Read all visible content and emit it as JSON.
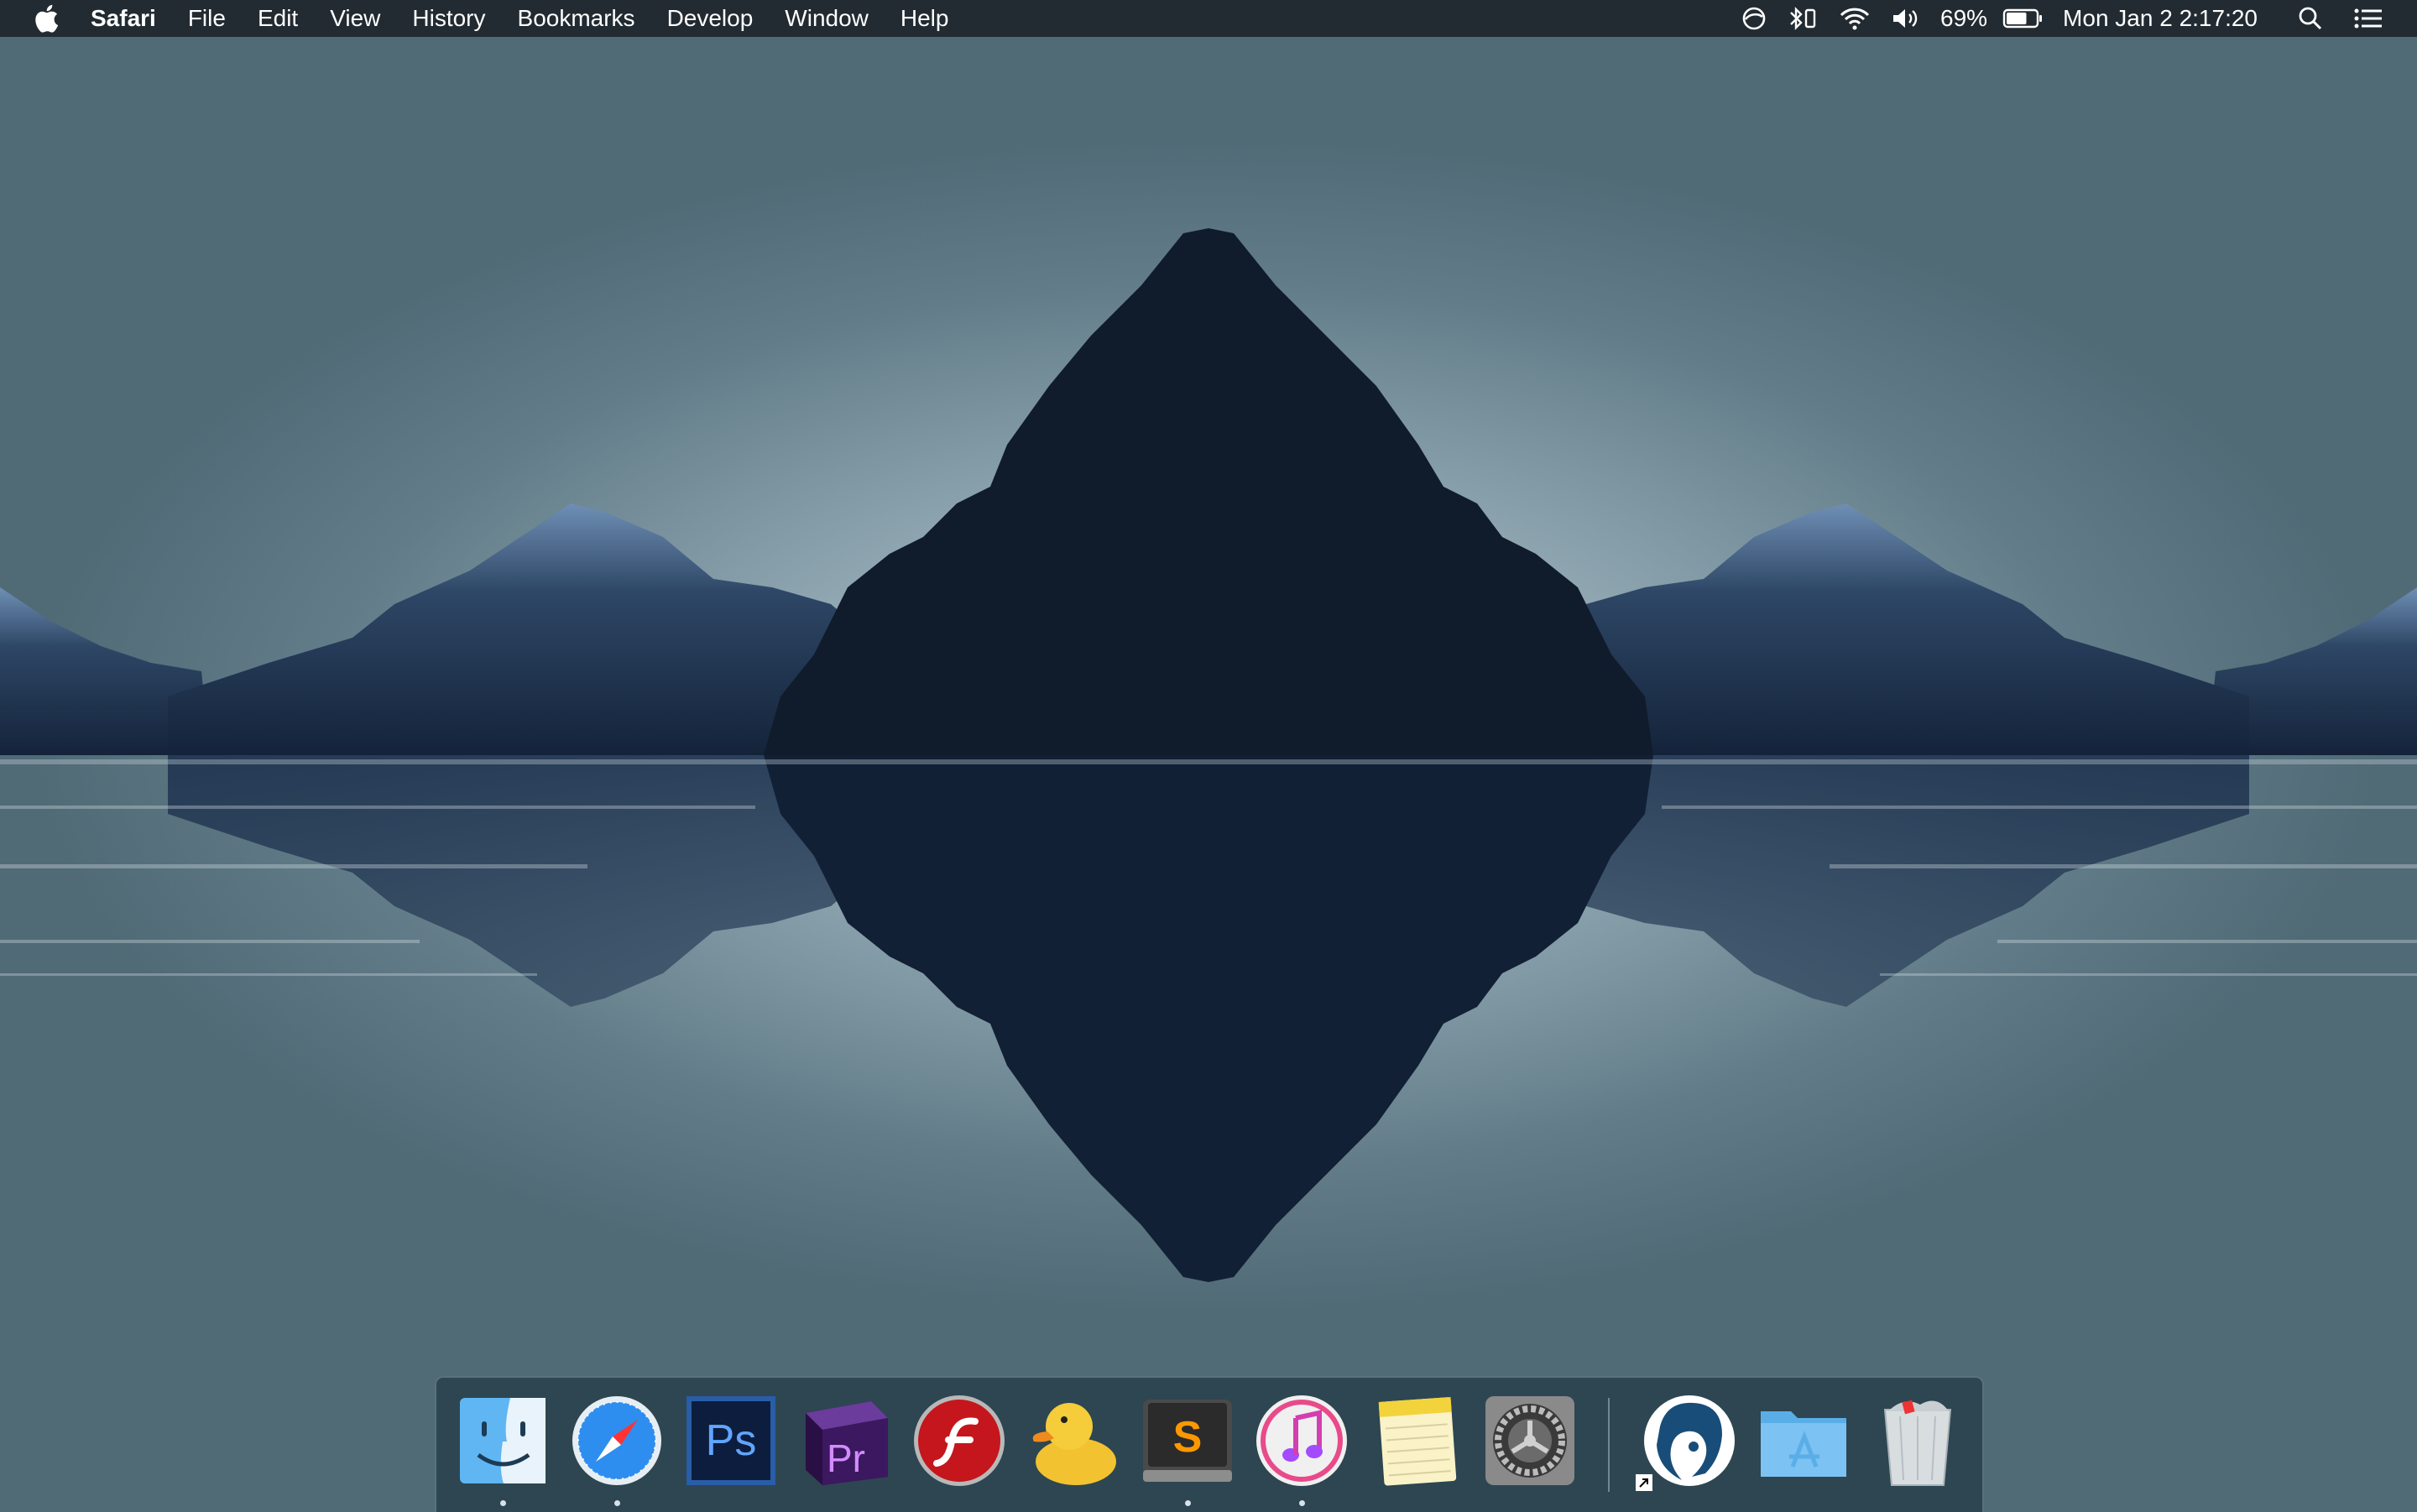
{
  "menubar": {
    "app_name": "Safari",
    "items": [
      "File",
      "Edit",
      "View",
      "History",
      "Bookmarks",
      "Develop",
      "Window",
      "Help"
    ],
    "battery_percent": "69%",
    "battery_level": 0.69,
    "clock": "Mon Jan 2  2:17:20",
    "status_icons": [
      "sync-icon",
      "bluetooth-icon",
      "wifi-icon",
      "volume-icon",
      "battery-icon",
      "spotlight-search-icon",
      "notification-center-icon"
    ]
  },
  "dock": {
    "apps": [
      {
        "name": "Finder",
        "icon": "finder-icon",
        "running": true
      },
      {
        "name": "Safari",
        "icon": "safari-icon",
        "running": true
      },
      {
        "name": "Adobe Photoshop",
        "icon": "photoshop-icon",
        "running": false,
        "label": "Ps"
      },
      {
        "name": "Adobe Premiere Pro",
        "icon": "premiere-icon",
        "running": false,
        "label": "Pr"
      },
      {
        "name": "Adobe Flash Player",
        "icon": "flash-icon",
        "running": false
      },
      {
        "name": "Cyberduck",
        "icon": "cyberduck-icon",
        "running": false
      },
      {
        "name": "Sublime Text",
        "icon": "sublime-text-icon",
        "running": true,
        "label": "S"
      },
      {
        "name": "iTunes",
        "icon": "itunes-icon",
        "running": true
      },
      {
        "name": "Notes",
        "icon": "notes-icon",
        "running": false
      },
      {
        "name": "System Preferences",
        "icon": "system-preferences-icon",
        "running": false
      },
      {
        "name": "Profile",
        "icon": "profile-avatar-icon",
        "running": false
      },
      {
        "name": "Applications",
        "icon": "applications-folder-icon",
        "running": false
      },
      {
        "name": "Trash",
        "icon": "trash-icon",
        "running": false
      }
    ]
  },
  "colors": {
    "menubar_bg": "#1e262c",
    "mountain_dark": "#101c2b",
    "mountain_side": "#2a3f58",
    "snow_highlight": "#6f8fb5",
    "sky_light": "#b9c8cf",
    "sky_dark": "#506a76"
  }
}
